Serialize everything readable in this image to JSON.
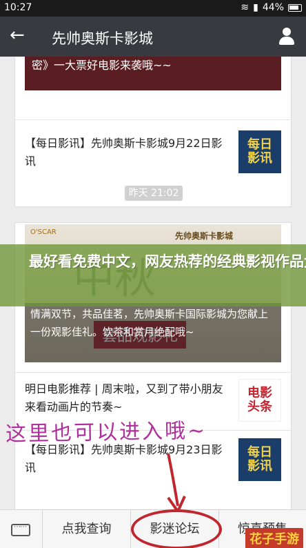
{
  "status": {
    "time": "10:27",
    "battery": "44%"
  },
  "header": {
    "title": "先帅奥斯卡影城"
  },
  "feed": {
    "card1": {
      "hero_caption": "密》一大票好电影来袭哦~~",
      "row_text": "【每日影讯】先帅奥斯卡影城9月22日影讯",
      "thumb_text_1": "每日",
      "thumb_text_2": "影讯"
    },
    "timestamp": "昨天 21:02",
    "card2": {
      "hero_logo": "O'SCAR",
      "hero_brand": "先帅奥斯卡影城",
      "hero_calli": "中秋",
      "hero_stamp": "套品观影礼",
      "hero_caption": "情满双节，共品佳茗，先帅奥斯卡国际影城为您献上一份观影佳礼。饮茶和赏月绝配哦~",
      "row1_text": "明日电影推荐 | 周末啦，又到了带小朋友来看动画片的节奏~",
      "row1_thumb_1": "电影",
      "row1_thumb_2": "头条",
      "row2_text": "【每日影讯】先帅奥斯卡影城9月23日影讯",
      "row2_thumb_1": "每日",
      "row2_thumb_2": "影讯"
    }
  },
  "overlay": {
    "banner": "最好看免费中文，网友热荐的经典影视作品大盘点，让你一次看",
    "handwriting": "这里也可以进入哦~"
  },
  "bottom_menu": {
    "item1": "点我查询",
    "item2": "影迷论坛",
    "item3": "惊喜预售"
  },
  "watermark": "花子手游",
  "colors": {
    "titlebar": "#393a3f",
    "banner": "#6e9637",
    "circle": "#c0262d",
    "handwriting": "#b02f9a"
  }
}
